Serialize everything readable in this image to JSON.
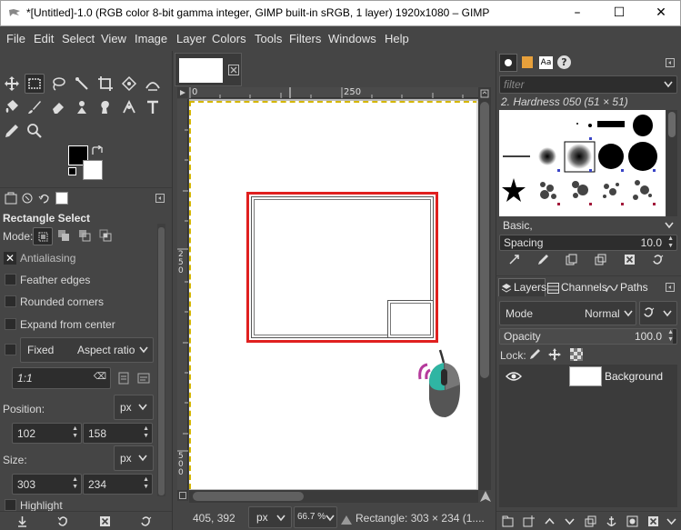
{
  "window": {
    "title": "*[Untitled]-1.0 (RGB color 8-bit gamma integer, GIMP built-in sRGB, 1 layer) 1920x1080 – GIMP",
    "minimize": "–",
    "maximize": "☐",
    "close": "✕"
  },
  "menu": [
    "File",
    "Edit",
    "Select",
    "View",
    "Image",
    "Layer",
    "Colors",
    "Tools",
    "Filters",
    "Windows",
    "Help"
  ],
  "tool_options": {
    "title": "Rectangle Select",
    "mode_label": "Mode:",
    "antialiasing": "Antialiasing",
    "feather_edges": "Feather edges",
    "rounded_corners": "Rounded corners",
    "expand_from_center": "Expand from center",
    "fixed": "Fixed",
    "aspect_ratio": "Aspect ratio",
    "ratio_value": "1:1",
    "position_label": "Position:",
    "position_unit": "px",
    "position_x": "102",
    "position_y": "158",
    "size_label": "Size:",
    "size_unit": "px",
    "size_w": "303",
    "size_h": "234",
    "highlight": "Highlight"
  },
  "canvas": {
    "ruler_top": [
      "0",
      "250"
    ],
    "ruler_left": [
      "2",
      "5",
      "0",
      "5",
      "0",
      "0"
    ]
  },
  "statusbar": {
    "coords": "405, 392",
    "unit": "px",
    "zoom": "66.7 %",
    "message": "Rectangle: 303 × 234  (1...."
  },
  "brushes": {
    "filter_placeholder": "filter",
    "selected": "2. Hardness 050 (51 × 51)",
    "preset": "Basic,",
    "spacing_label": "Spacing",
    "spacing_value": "10.0"
  },
  "layers": {
    "tab_layers": "Layers",
    "tab_channels": "Channels",
    "tab_paths": "Paths",
    "mode_label": "Mode",
    "mode_value": "Normal",
    "opacity_label": "Opacity",
    "opacity_value": "100.0",
    "lock_label": "Lock:",
    "layer_name": "Background"
  },
  "colors": {
    "selection_outline": "#e0201f",
    "mouse_teal": "#2fb5a3",
    "mouse_purple": "#b53a9c"
  }
}
